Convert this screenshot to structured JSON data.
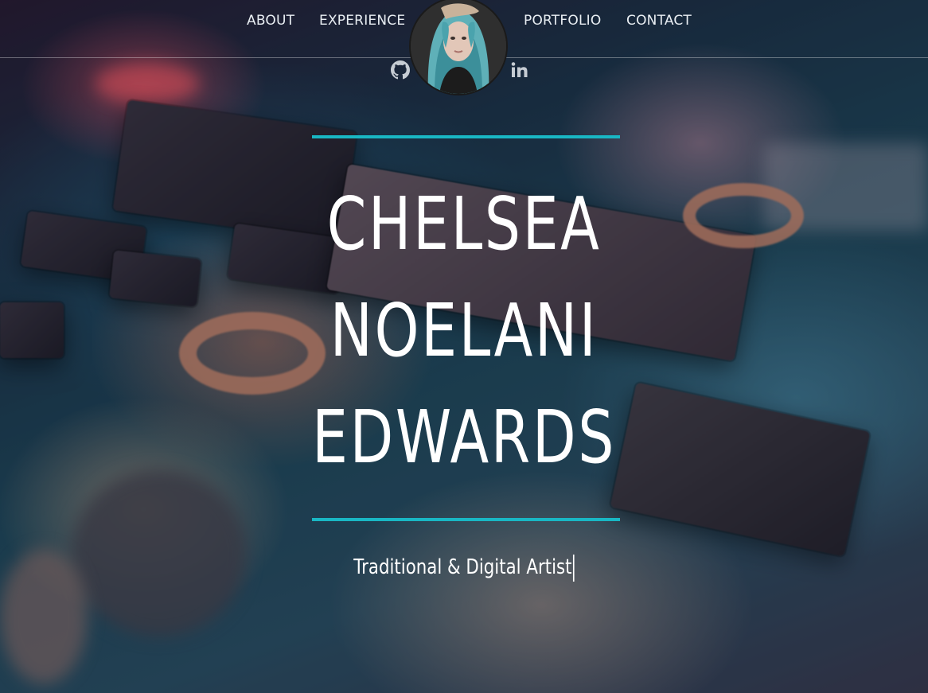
{
  "nav": {
    "items": [
      {
        "label": "ABOUT"
      },
      {
        "label": "EXPERIENCE"
      },
      {
        "label": "PORTFOLIO"
      },
      {
        "label": "CONTACT"
      }
    ],
    "social": [
      {
        "icon": "github-icon"
      },
      {
        "icon": "linkedin-icon"
      }
    ]
  },
  "hero": {
    "name_lines": [
      "CHELSEA",
      "NOELANI",
      "EDWARDS"
    ],
    "tagline": "Traditional & Digital Artist",
    "accent_color": "#19b7c4"
  }
}
